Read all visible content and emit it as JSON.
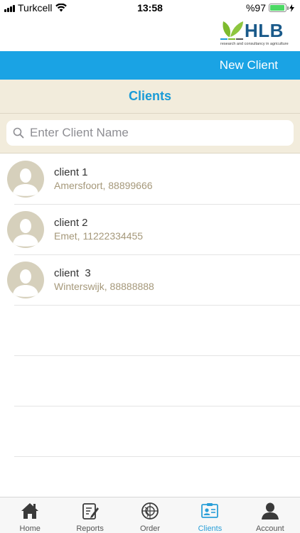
{
  "status": {
    "carrier": "Turkcell",
    "time": "13:58",
    "battery": "%97",
    "battery_level": 0.97
  },
  "logo": {
    "text": "HLB",
    "tagline": "research and consultancy in agriculture"
  },
  "header": {
    "new_client_label": "New Client"
  },
  "page": {
    "title": "Clients"
  },
  "search": {
    "placeholder": "Enter Client Name"
  },
  "clients": [
    {
      "name": "client 1",
      "details": "Amersfoort, 88899666"
    },
    {
      "name": "client 2",
      "details": "Emet, 11222334455"
    },
    {
      "name": "client  3",
      "details": "Winterswijk, 88888888"
    }
  ],
  "tabs": [
    {
      "label": "Home",
      "icon": "home-icon",
      "active": false
    },
    {
      "label": "Reports",
      "icon": "reports-icon",
      "active": false
    },
    {
      "label": "Order",
      "icon": "order-icon",
      "active": false
    },
    {
      "label": "Clients",
      "icon": "clients-icon",
      "active": true
    },
    {
      "label": "Account",
      "icon": "account-icon",
      "active": false
    }
  ],
  "colors": {
    "accent": "#1aa3e4",
    "title": "#1a9bd7",
    "cream": "#f2ecdc",
    "sub_text": "#a5987a",
    "active_tab": "#2a9fd8"
  }
}
